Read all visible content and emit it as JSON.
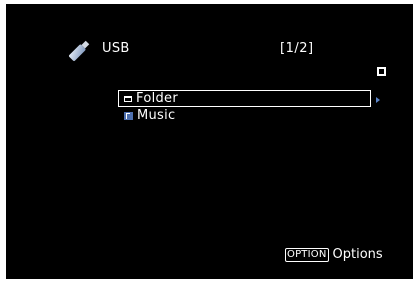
{
  "header": {
    "source_label": "USB",
    "page_indicator": "[1/2]",
    "source_icon": "usb-stick-icon",
    "playback_state_icon": "stop-icon"
  },
  "list": {
    "items": [
      {
        "label": "Folder",
        "icon": "folder-icon",
        "selected": true
      },
      {
        "label": "Music",
        "icon": "music-icon",
        "selected": false
      }
    ],
    "next_icon": "arrow-right-icon"
  },
  "footer": {
    "option_key": "OPTION",
    "option_label": "Options"
  },
  "colors": {
    "background": "#000000",
    "text": "#ffffff",
    "accent": "#5a83c6"
  }
}
